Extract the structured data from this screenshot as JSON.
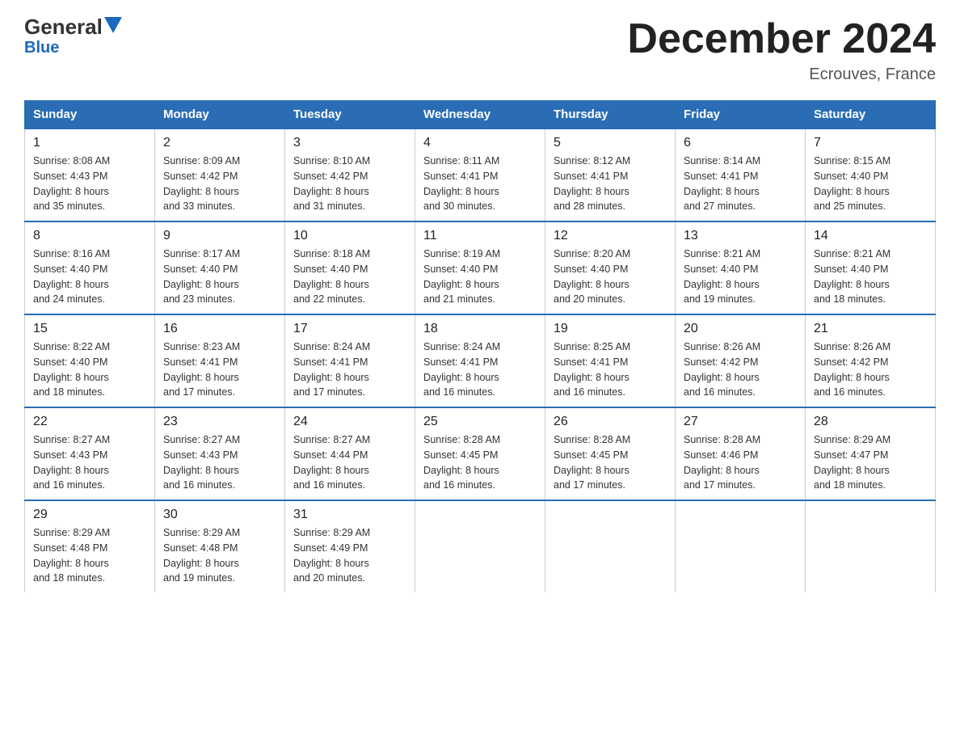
{
  "header": {
    "logo_general": "General",
    "logo_blue": "Blue",
    "month_title": "December 2024",
    "location": "Ecrouves, France"
  },
  "days_header": [
    "Sunday",
    "Monday",
    "Tuesday",
    "Wednesday",
    "Thursday",
    "Friday",
    "Saturday"
  ],
  "weeks": [
    [
      {
        "num": "1",
        "sunrise": "8:08 AM",
        "sunset": "4:43 PM",
        "daylight": "8 hours and 35 minutes."
      },
      {
        "num": "2",
        "sunrise": "8:09 AM",
        "sunset": "4:42 PM",
        "daylight": "8 hours and 33 minutes."
      },
      {
        "num": "3",
        "sunrise": "8:10 AM",
        "sunset": "4:42 PM",
        "daylight": "8 hours and 31 minutes."
      },
      {
        "num": "4",
        "sunrise": "8:11 AM",
        "sunset": "4:41 PM",
        "daylight": "8 hours and 30 minutes."
      },
      {
        "num": "5",
        "sunrise": "8:12 AM",
        "sunset": "4:41 PM",
        "daylight": "8 hours and 28 minutes."
      },
      {
        "num": "6",
        "sunrise": "8:14 AM",
        "sunset": "4:41 PM",
        "daylight": "8 hours and 27 minutes."
      },
      {
        "num": "7",
        "sunrise": "8:15 AM",
        "sunset": "4:40 PM",
        "daylight": "8 hours and 25 minutes."
      }
    ],
    [
      {
        "num": "8",
        "sunrise": "8:16 AM",
        "sunset": "4:40 PM",
        "daylight": "8 hours and 24 minutes."
      },
      {
        "num": "9",
        "sunrise": "8:17 AM",
        "sunset": "4:40 PM",
        "daylight": "8 hours and 23 minutes."
      },
      {
        "num": "10",
        "sunrise": "8:18 AM",
        "sunset": "4:40 PM",
        "daylight": "8 hours and 22 minutes."
      },
      {
        "num": "11",
        "sunrise": "8:19 AM",
        "sunset": "4:40 PM",
        "daylight": "8 hours and 21 minutes."
      },
      {
        "num": "12",
        "sunrise": "8:20 AM",
        "sunset": "4:40 PM",
        "daylight": "8 hours and 20 minutes."
      },
      {
        "num": "13",
        "sunrise": "8:21 AM",
        "sunset": "4:40 PM",
        "daylight": "8 hours and 19 minutes."
      },
      {
        "num": "14",
        "sunrise": "8:21 AM",
        "sunset": "4:40 PM",
        "daylight": "8 hours and 18 minutes."
      }
    ],
    [
      {
        "num": "15",
        "sunrise": "8:22 AM",
        "sunset": "4:40 PM",
        "daylight": "8 hours and 18 minutes."
      },
      {
        "num": "16",
        "sunrise": "8:23 AM",
        "sunset": "4:41 PM",
        "daylight": "8 hours and 17 minutes."
      },
      {
        "num": "17",
        "sunrise": "8:24 AM",
        "sunset": "4:41 PM",
        "daylight": "8 hours and 17 minutes."
      },
      {
        "num": "18",
        "sunrise": "8:24 AM",
        "sunset": "4:41 PM",
        "daylight": "8 hours and 16 minutes."
      },
      {
        "num": "19",
        "sunrise": "8:25 AM",
        "sunset": "4:41 PM",
        "daylight": "8 hours and 16 minutes."
      },
      {
        "num": "20",
        "sunrise": "8:26 AM",
        "sunset": "4:42 PM",
        "daylight": "8 hours and 16 minutes."
      },
      {
        "num": "21",
        "sunrise": "8:26 AM",
        "sunset": "4:42 PM",
        "daylight": "8 hours and 16 minutes."
      }
    ],
    [
      {
        "num": "22",
        "sunrise": "8:27 AM",
        "sunset": "4:43 PM",
        "daylight": "8 hours and 16 minutes."
      },
      {
        "num": "23",
        "sunrise": "8:27 AM",
        "sunset": "4:43 PM",
        "daylight": "8 hours and 16 minutes."
      },
      {
        "num": "24",
        "sunrise": "8:27 AM",
        "sunset": "4:44 PM",
        "daylight": "8 hours and 16 minutes."
      },
      {
        "num": "25",
        "sunrise": "8:28 AM",
        "sunset": "4:45 PM",
        "daylight": "8 hours and 16 minutes."
      },
      {
        "num": "26",
        "sunrise": "8:28 AM",
        "sunset": "4:45 PM",
        "daylight": "8 hours and 17 minutes."
      },
      {
        "num": "27",
        "sunrise": "8:28 AM",
        "sunset": "4:46 PM",
        "daylight": "8 hours and 17 minutes."
      },
      {
        "num": "28",
        "sunrise": "8:29 AM",
        "sunset": "4:47 PM",
        "daylight": "8 hours and 18 minutes."
      }
    ],
    [
      {
        "num": "29",
        "sunrise": "8:29 AM",
        "sunset": "4:48 PM",
        "daylight": "8 hours and 18 minutes."
      },
      {
        "num": "30",
        "sunrise": "8:29 AM",
        "sunset": "4:48 PM",
        "daylight": "8 hours and 19 minutes."
      },
      {
        "num": "31",
        "sunrise": "8:29 AM",
        "sunset": "4:49 PM",
        "daylight": "8 hours and 20 minutes."
      },
      null,
      null,
      null,
      null
    ]
  ],
  "labels": {
    "sunrise_prefix": "Sunrise: ",
    "sunset_prefix": "Sunset: ",
    "daylight_prefix": "Daylight: "
  }
}
